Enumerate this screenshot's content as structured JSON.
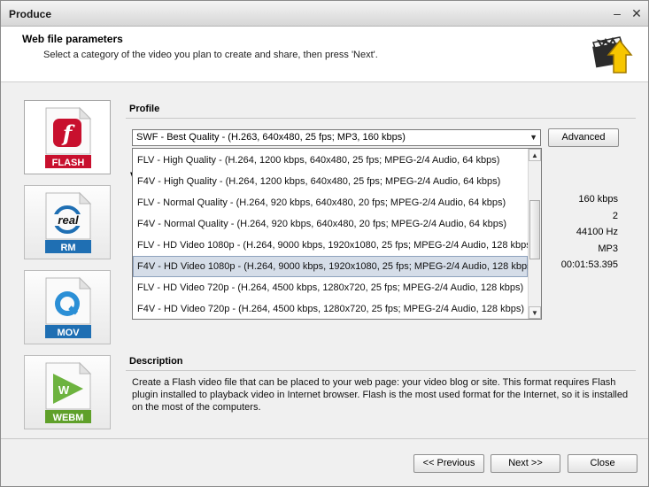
{
  "window": {
    "title": "Produce"
  },
  "header": {
    "title": "Web file parameters",
    "subtitle": "Select a category of the video you plan to create and share, then press 'Next'."
  },
  "formats": [
    {
      "label": "FLASH",
      "icon": "flash-icon",
      "color": "#c8102e"
    },
    {
      "label": "RM",
      "icon": "real-icon",
      "color": "#1f6fb3"
    },
    {
      "label": "MOV",
      "icon": "quicktime-icon",
      "color": "#1f6fb3"
    },
    {
      "label": "WEBM",
      "icon": "webm-icon",
      "color": "#5fa02a"
    }
  ],
  "profile": {
    "label": "Profile",
    "selected": "SWF - Best Quality - (H.263, 640x480, 25 fps; MP3, 160 kbps)",
    "advanced_label": "Advanced",
    "options": [
      "FLV - High Quality - (H.264, 1200 kbps, 640x480, 25 fps; MPEG-2/4 Audio, 64 kbps)",
      "F4V - High Quality - (H.264, 1200 kbps, 640x480, 25 fps; MPEG-2/4 Audio, 64 kbps)",
      "FLV - Normal Quality - (H.264, 920 kbps, 640x480, 20 fps; MPEG-2/4 Audio, 64 kbps)",
      "F4V - Normal Quality - (H.264, 920 kbps, 640x480, 20 fps; MPEG-2/4 Audio, 64 kbps)",
      "FLV - HD Video 1080p - (H.264, 9000 kbps, 1920x1080, 25 fps; MPEG-2/4 Audio, 128 kbps)",
      "F4V - HD Video 1080p - (H.264, 9000 kbps, 1920x1080, 25 fps; MPEG-2/4 Audio, 128 kbps)",
      "FLV - HD Video 720p - (H.264, 4500 kbps, 1280x720, 25 fps; MPEG-2/4 Audio, 128 kbps)",
      "F4V - HD Video 720p - (H.264, 4500 kbps, 1280x720, 25 fps; MPEG-2/4 Audio, 128 kbps)"
    ],
    "highlighted_index": 5
  },
  "properties": {
    "partial_heading": "V",
    "values": [
      "160 kbps",
      "2",
      "44100 Hz",
      "MP3",
      "00:01:53.395"
    ]
  },
  "description": {
    "label": "Description",
    "text": "Create a Flash video file that can be placed to your web page: your video blog or site. This format requires Flash plugin installed to playback video in Internet browser. Flash is the most used format for the Internet, so it is installed on the most of the computers."
  },
  "footer": {
    "previous_label": "<< Previous",
    "next_label": "Next >>",
    "close_label": "Close"
  }
}
